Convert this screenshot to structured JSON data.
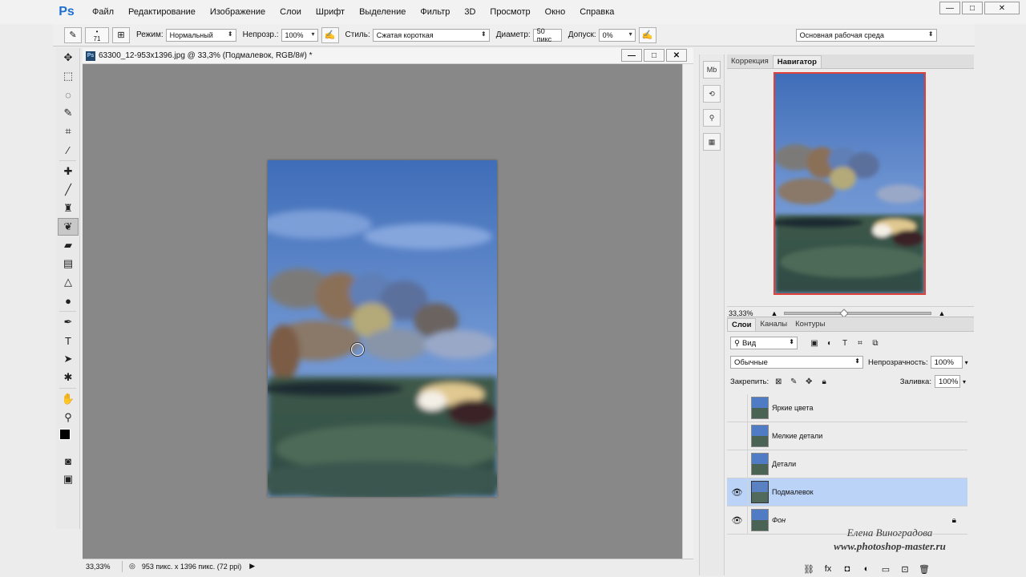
{
  "menubar": {
    "logo": "Ps",
    "items": [
      "Файл",
      "Редактирование",
      "Изображение",
      "Слои",
      "Шрифт",
      "Выделение",
      "Фильтр",
      "3D",
      "Просмотр",
      "Окно",
      "Справка"
    ],
    "window_controls": [
      "—",
      "□",
      "✕"
    ]
  },
  "options": {
    "brush_size": "71",
    "mode_label": "Режим:",
    "mode_value": "Нормальный",
    "opacity_label": "Непрозр.:",
    "opacity_value": "100%",
    "style_label": "Стиль:",
    "style_value": "Сжатая короткая",
    "diameter_label": "Диаметр:",
    "diameter_value": "50 пикс",
    "tolerance_label": "Допуск:",
    "tolerance_value": "0%",
    "workspace_value": "Основная рабочая среда"
  },
  "document": {
    "title": "63300_12-953x1396.jpg @ 33,3% (Подмалевок, RGB/8#) *",
    "zoom": "33,33%",
    "dimensions": "953 пикс. x 1396 пикс. (72 ppi)",
    "icon_text": "Ps"
  },
  "panels": {
    "tab_correction": "Коррекция",
    "tab_navigator": "Навигатор",
    "nav_zoom": "33,33%",
    "layers_tab": "Слои",
    "channels_tab": "Каналы",
    "paths_tab": "Контуры",
    "filter_kind": "Вид",
    "blend_mode": "Обычные",
    "opacity_label": "Непрозрачность:",
    "opacity_value": "100%",
    "lock_label": "Закрепить:",
    "fill_label": "Заливка:",
    "fill_value": "100%"
  },
  "layers": [
    {
      "name": "Яркие цвета",
      "visible": false,
      "selected": false,
      "locked": false
    },
    {
      "name": "Мелкие детали",
      "visible": false,
      "selected": false,
      "locked": false
    },
    {
      "name": "Детали",
      "visible": false,
      "selected": false,
      "locked": false
    },
    {
      "name": "Подмалевок",
      "visible": true,
      "selected": true,
      "locked": false
    },
    {
      "name": "Фон",
      "visible": true,
      "selected": false,
      "locked": true
    }
  ],
  "watermark": {
    "line1": "Елена Виноградова",
    "line2": "www.photoshop-master.ru"
  },
  "colors": {
    "accent_selected": "#bcd3f8",
    "navigator_frame": "#e0403a",
    "canvas_bg": "#888888"
  }
}
